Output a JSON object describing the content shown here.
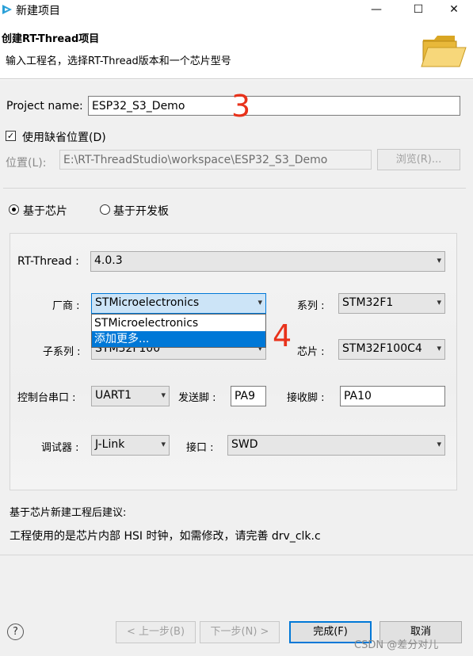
{
  "window": {
    "title": "新建项目",
    "minimize": "—",
    "maximize": "☐",
    "close": "✕"
  },
  "header": {
    "title": "创建RT-Thread项目",
    "description": "输入工程名，选择RT-Thread版本和一个芯片型号"
  },
  "project": {
    "name_label": "Project name:",
    "name_value": "ESP32_S3_Demo",
    "use_default_label": "使用缺省位置(D)",
    "use_default_checked": true,
    "location_label": "位置(L):",
    "location_value": "E:\\RT-ThreadStudio\\workspace\\ESP32_S3_Demo",
    "browse_button": "浏览(R)..."
  },
  "mode": {
    "chip_label": "基于芯片",
    "board_label": "基于开发板",
    "selected": "chip"
  },
  "form": {
    "rtthread_label": "RT-Thread :",
    "rtthread_value": "4.0.3",
    "vendor_label": "厂商 :",
    "vendor_value": "STMicroelectronics",
    "series_label": "系列 :",
    "series_value": "STM32F1",
    "subseries_label": "子系列 :",
    "subseries_value": "STM32F100",
    "chip_label": "芯片 :",
    "chip_value": "STM32F100C4",
    "console_label": "控制台串口 :",
    "console_value": "UART1",
    "tx_label": "发送脚 :",
    "tx_value": "PA9",
    "rx_label": "接收脚 :",
    "rx_value": "PA10",
    "debugger_label": "调试器 :",
    "debugger_value": "J-Link",
    "interface_label": "接口 :",
    "interface_value": "SWD"
  },
  "vendor_dropdown": {
    "options": [
      "STMicroelectronics",
      "添加更多..."
    ],
    "highlighted_index": 1
  },
  "advice": {
    "title": "基于芯片新建工程后建议:",
    "text": "工程使用的是芯片内部 HSI 时钟，如需修改，请完善 drv_clk.c"
  },
  "footer": {
    "help": "?",
    "back": "< 上一步(B)",
    "next": "下一步(N) >",
    "finish": "完成(F)",
    "cancel": "取消"
  },
  "annotations": {
    "mark_a": "3",
    "mark_b": "4",
    "color": "#e8321b"
  },
  "watermark": "CSDN @差分对儿"
}
